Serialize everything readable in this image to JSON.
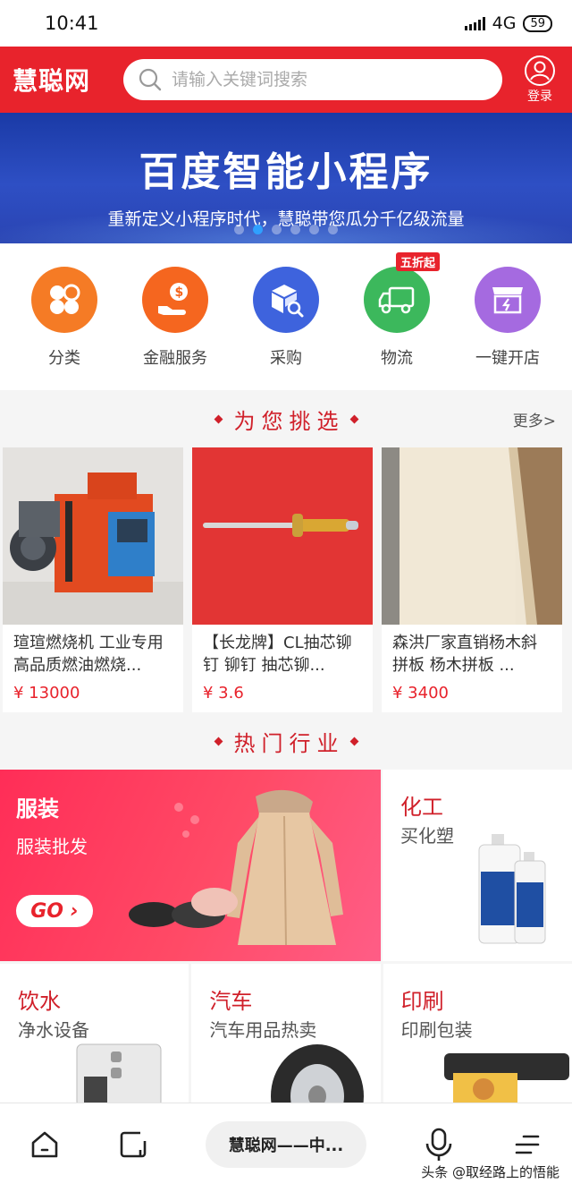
{
  "status_bar": {
    "time": "10:41",
    "network": "4G",
    "battery": "59"
  },
  "header": {
    "logo": "慧聪网",
    "search_placeholder": "请输入关键词搜索",
    "login_label": "登录"
  },
  "banner": {
    "title": "百度智能小程序",
    "subtitle": "重新定义小程序时代，慧聪带您瓜分千亿级流量",
    "slide_count": 6,
    "active_slide": 2
  },
  "categories": [
    {
      "label": "分类",
      "icon": "clover-icon",
      "color": "#f57b25"
    },
    {
      "label": "金融服务",
      "icon": "money-hand-icon",
      "color": "#f5661f"
    },
    {
      "label": "采购",
      "icon": "box-search-icon",
      "color": "#3e63dd"
    },
    {
      "label": "物流",
      "icon": "truck-icon",
      "color": "#3cb85c",
      "tag": "五折起"
    },
    {
      "label": "一键开店",
      "icon": "shop-icon",
      "color": "#a56ae0"
    }
  ],
  "recommend": {
    "title": "为您挑选",
    "more": "更多>",
    "products": [
      {
        "name": "瑄瑄燃烧机 工业专用高品质燃油燃烧...",
        "price": "¥ 13000",
        "image": "burner-machine"
      },
      {
        "name": "【长龙牌】CL抽芯铆钉 铆钉 抽芯铆...",
        "price": "¥ 3.6",
        "image": "rivet"
      },
      {
        "name": "森洪厂家直销杨木斜拼板 杨木拼板 ...",
        "price": "¥ 3400",
        "image": "poplar-board"
      }
    ]
  },
  "industries": {
    "title": "热门行业",
    "featured": {
      "name": "服装",
      "sub": "服装批发",
      "go": "GO"
    },
    "side": {
      "name": "化工",
      "sub": "买化塑"
    },
    "row": [
      {
        "name": "饮水",
        "sub": "净水设备"
      },
      {
        "name": "汽车",
        "sub": "汽车用品热卖"
      },
      {
        "name": "印刷",
        "sub": "印刷包装"
      }
    ]
  },
  "bottom_bar": {
    "tab_title": "慧聪网——中...",
    "watermark": "头条 @取经路上的悟能"
  }
}
